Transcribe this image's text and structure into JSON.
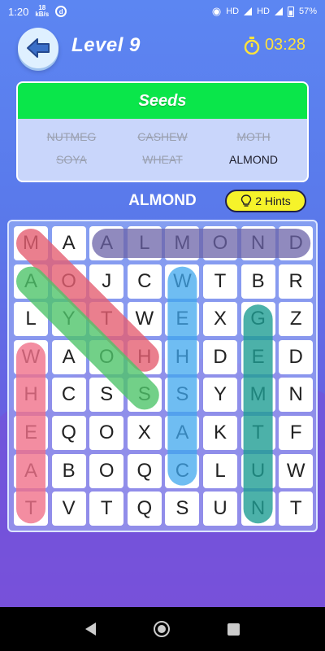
{
  "status_bar": {
    "time": "1:20",
    "speed_value": "18",
    "speed_unit": "kB/s",
    "network_1": "HD",
    "network_2": "HD",
    "battery": "57%"
  },
  "header": {
    "level_title": "Level 9",
    "timer": "03:28"
  },
  "word_panel": {
    "category": "Seeds",
    "words": [
      {
        "text": "NUTMEG",
        "found": true
      },
      {
        "text": "CASHEW",
        "found": true
      },
      {
        "text": "MOTH",
        "found": true
      },
      {
        "text": "SOYA",
        "found": true
      },
      {
        "text": "WHEAT",
        "found": true
      },
      {
        "text": "ALMOND",
        "found": false
      }
    ]
  },
  "current_word": "ALMOND",
  "hints_label": "2 Hints",
  "grid": [
    [
      "M",
      "A",
      "A",
      "L",
      "M",
      "O",
      "N",
      "D"
    ],
    [
      "A",
      "O",
      "J",
      "C",
      "W",
      "T",
      "B",
      "R"
    ],
    [
      "L",
      "Y",
      "T",
      "W",
      "E",
      "X",
      "G",
      "Z"
    ],
    [
      "W",
      "A",
      "O",
      "H",
      "H",
      "D",
      "E",
      "D"
    ],
    [
      "H",
      "C",
      "S",
      "S",
      "S",
      "Y",
      "M",
      "N"
    ],
    [
      "E",
      "Q",
      "O",
      "X",
      "A",
      "K",
      "T",
      "F"
    ],
    [
      "A",
      "B",
      "O",
      "Q",
      "C",
      "L",
      "U",
      "W"
    ],
    [
      "T",
      "V",
      "T",
      "Q",
      "S",
      "U",
      "N",
      "T"
    ]
  ],
  "highlights": [
    {
      "word": "ALMOND",
      "from": [
        0,
        2
      ],
      "to": [
        0,
        7
      ],
      "color": "#6b63a8",
      "opacity": 0.75
    },
    {
      "word": "MOTH",
      "from": [
        0,
        0
      ],
      "to": [
        3,
        3
      ],
      "color": "#e55f72",
      "opacity": 0.8
    },
    {
      "word": "SOYA",
      "from": [
        4,
        3
      ],
      "to": [
        1,
        0
      ],
      "color": "#4fc46a",
      "opacity": 0.8
    },
    {
      "word": "CASHEW",
      "from": [
        6,
        4
      ],
      "to": [
        1,
        4
      ],
      "color": "#3fa7ee",
      "opacity": 0.75
    },
    {
      "word": "NUTMEG",
      "from": [
        7,
        6
      ],
      "to": [
        2,
        6
      ],
      "color": "#1f9e93",
      "opacity": 0.8
    },
    {
      "word": "WHEAT",
      "from": [
        3,
        0
      ],
      "to": [
        7,
        0
      ],
      "color": "#f0708a",
      "opacity": 0.8
    }
  ],
  "colors": {
    "accent_green": "#0ae64a",
    "timer_yellow": "#ffe23c",
    "hint_yellow": "#f6f32a"
  },
  "icons": {
    "back": "arrow-left-icon",
    "timer": "stopwatch-icon",
    "hint": "lightbulb-icon"
  }
}
